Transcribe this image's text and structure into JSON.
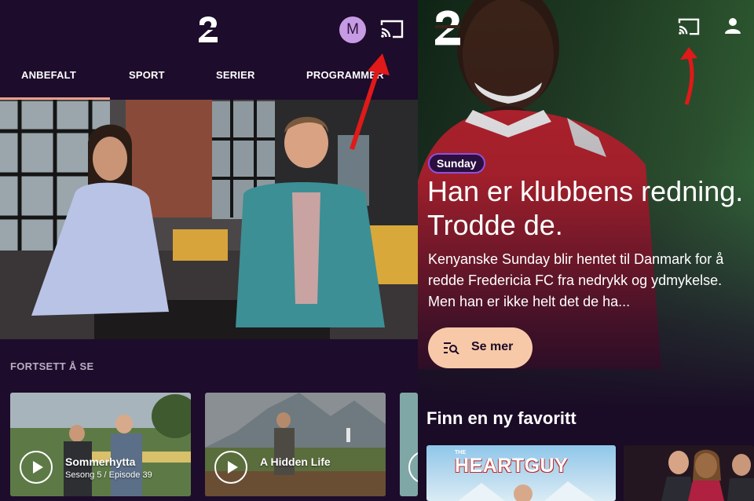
{
  "left_screen": {
    "header": {
      "logo": "tv2-logo",
      "avatar_initial": "M",
      "cast_icon": "cast-icon"
    },
    "nav": [
      "ANBEFALT",
      "SPORT",
      "SERIER",
      "PROGRAMMER"
    ],
    "continue_watching": {
      "title": "FORTSETT Å SE",
      "cards": [
        {
          "title": "Sommerhytta",
          "subtitle": "Sesong 5 / Episode 39"
        },
        {
          "title": "A Hidden Life",
          "subtitle": ""
        }
      ]
    }
  },
  "right_screen": {
    "header": {
      "logo": "tv2-logo",
      "cast_icon": "cast-icon",
      "profile_icon": "person-icon"
    },
    "hero": {
      "tag": "Sunday",
      "headline": "Han er klubbens redning. Trodde de.",
      "description": "Kenyanske Sunday blir hentet til Danmark for å redde Fredericia FC fra nedrykk og ydmykelse. Men han er ikke helt det de ha...",
      "button": "Se mer"
    },
    "favorites": {
      "title": "Finn en ny favoritt",
      "posters": [
        {
          "small": "THE",
          "title": "HEARTGUY"
        }
      ]
    }
  },
  "colors": {
    "background": "#1d0c2b",
    "accent_peach": "#f8c9a9",
    "tag_border": "#8f4fe0",
    "arrow": "#e01919",
    "avatar": "#c79be4"
  }
}
